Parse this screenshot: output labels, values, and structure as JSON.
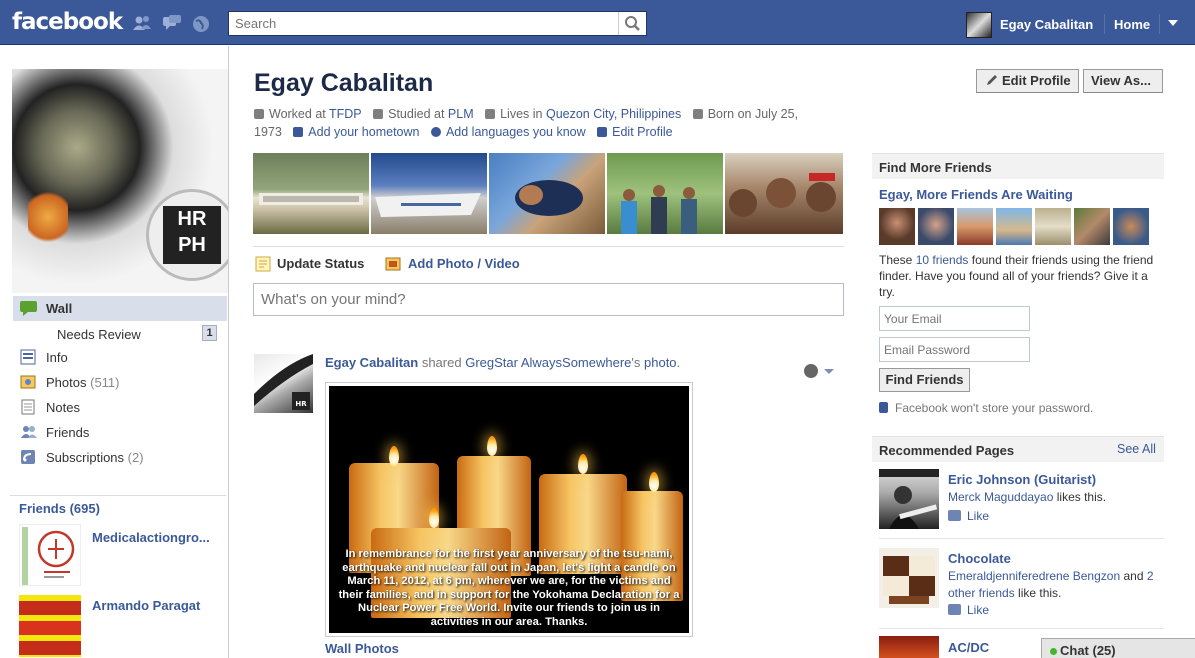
{
  "topbar": {
    "logo": "facebook",
    "search_placeholder": "Search",
    "user_name": "Egay Cabalitan",
    "home_label": "Home"
  },
  "profile": {
    "name": "Egay Cabalitan",
    "edit_profile_button": "Edit Profile",
    "view_as_button": "View As...",
    "info": {
      "worked_prefix": "Worked at",
      "worked_at": "TFDP",
      "studied_prefix": "Studied at",
      "studied_at": "PLM",
      "lives_prefix": "Lives in",
      "lives_in": "Quezon City, Philippines",
      "born": "Born on July 25, 1973",
      "add_hometown": "Add your hometown",
      "add_languages": "Add languages you know",
      "edit_profile_link": "Edit Profile"
    },
    "badge_text": "HR PH"
  },
  "left_nav": {
    "items": [
      {
        "label": "Wall"
      },
      {
        "label": "Needs Review",
        "badge": "1"
      },
      {
        "label": "Info"
      },
      {
        "label": "Photos",
        "count": "(511)"
      },
      {
        "label": "Notes"
      },
      {
        "label": "Friends"
      },
      {
        "label": "Subscriptions",
        "count": "(2)"
      }
    ],
    "friends_heading": "Friends (695)",
    "friends": [
      {
        "name": "Medicalactiongro..."
      },
      {
        "name": "Armando Paragat"
      }
    ]
  },
  "composer": {
    "update_status": "Update Status",
    "add_photo_video": "Add Photo / Video",
    "placeholder": "What's on your mind?"
  },
  "story": {
    "author": "Egay Cabalitan",
    "verb": "shared",
    "source": "GregStar AlwaysSomewhere",
    "possessive": "'s",
    "object": "photo",
    "period": ".",
    "image_caption": "In remembrance for the first year anniversary of the tsu-nami, earthquake and nuclear fall out in Japan, let's light a candle on March 11, 2012, at 6 pm, wherever we are, for the victims and their families, and in support for the Yokohama Declaration for a Nuclear Power Free World. Invite our friends to join us in activities in our area. Thanks.",
    "album_link": "Wall Photos"
  },
  "find_friends": {
    "heading": "Find More Friends",
    "subheading": "Egay, More Friends Are Waiting",
    "text_prefix": "These",
    "friends_link": "10 friends",
    "text_suffix": "found their friends using the friend finder. Have you found all of your friends? Give it a try.",
    "email_placeholder": "Your Email",
    "password_placeholder": "Email Password",
    "button": "Find Friends",
    "note": "Facebook won't store your password."
  },
  "recommended": {
    "heading": "Recommended Pages",
    "see_all": "See All",
    "pages": [
      {
        "name": "Eric Johnson (Guitarist)",
        "liker": "Merck Maguddayao",
        "likes_text": "likes this.",
        "like_label": "Like"
      },
      {
        "name": "Chocolate",
        "liker": "Emeraldjenniferedrene Bengzon",
        "and_text": "and",
        "others": "2 other friends",
        "likes_text": "like this.",
        "like_label": "Like"
      },
      {
        "name": "AC/DC"
      }
    ]
  },
  "chat": {
    "label": "Chat (25)"
  },
  "colors": {
    "topbar": "#3b5998",
    "link": "#3b5998",
    "nav_selected": "#d8dfea",
    "right_header_bg": "#f2f2f2"
  }
}
